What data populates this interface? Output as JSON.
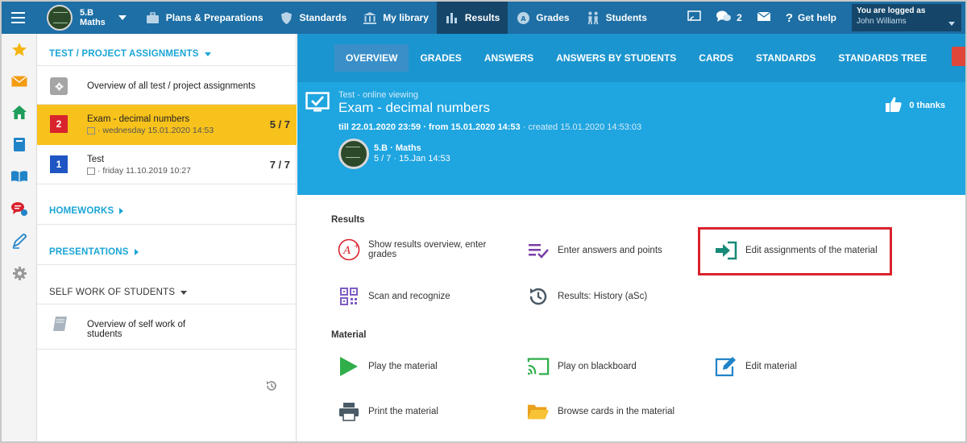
{
  "topbar": {
    "class_name_line1": "5.B",
    "class_name_line2": "Maths",
    "nav": [
      {
        "label": "Plans & Preparations",
        "icon": "briefcase-icon"
      },
      {
        "label": "Standards",
        "icon": "shield-icon"
      },
      {
        "label": "My library",
        "icon": "library-icon"
      },
      {
        "label": "Results",
        "icon": "bar-chart-icon",
        "active": true
      },
      {
        "label": "Grades",
        "icon": "grade-badge-icon"
      },
      {
        "label": "Students",
        "icon": "students-icon"
      }
    ],
    "message_count": "2",
    "help_label": "Get help",
    "logged_label": "You are logged as",
    "user_name": "John Williams"
  },
  "left": {
    "test_section": "TEST / PROJECT ASSIGNMENTS",
    "overview_all": "Overview of all test / project assignments",
    "assignments": [
      {
        "number": "2",
        "title": "Exam - decimal numbers",
        "subtitle": "· wednesday 15.01.2020 14:53",
        "score": "5 / 7",
        "badge_color": "#d9232d",
        "selected": true
      },
      {
        "number": "1",
        "title": "Test",
        "subtitle": "· friday 11.10.2019 10:27",
        "score": "7 / 7",
        "badge_color": "#2056c4",
        "selected": false
      }
    ],
    "homeworks": "HOMEWORKS",
    "presentations": "PRESENTATIONS",
    "self_work": "SELF WORK OF STUDENTS",
    "self_work_overview_1": "Overview of self work of",
    "self_work_overview_2": "students"
  },
  "tabs": [
    "OVERVIEW",
    "GRADES",
    "ANSWERS",
    "ANSWERS BY STUDENTS",
    "CARDS",
    "STANDARDS",
    "STANDARDS TREE"
  ],
  "hero": {
    "kind": "Test - online viewing",
    "title": "Exam - decimal numbers",
    "date_till": "till 22.01.2020 23:59",
    "date_from": " · from 15.01.2020 14:53",
    "date_created": " · created 15.01.2020 14:53:03",
    "class_name": "5.B · Maths",
    "class_sub": "5 / 7 · 15.Jan 14:53",
    "thanks": "0 thanks"
  },
  "results": {
    "heading": "Results",
    "show_overview_1": "Show results overview, enter",
    "show_overview_2": "grades",
    "enter_answers": "Enter answers and points",
    "edit_assignments": "Edit assignments of the material",
    "scan": "Scan and recognize",
    "history": "Results: History (aSc)"
  },
  "material": {
    "heading": "Material",
    "play": "Play the material",
    "blackboard": "Play on blackboard",
    "edit": "Edit material",
    "print": "Print the material",
    "browse": "Browse cards in the material"
  },
  "colors": {
    "topbar": "#1d6fa5",
    "accent": "#1fa5e0",
    "selected_row": "#f8c21c",
    "highlight_box": "#d9232d"
  }
}
